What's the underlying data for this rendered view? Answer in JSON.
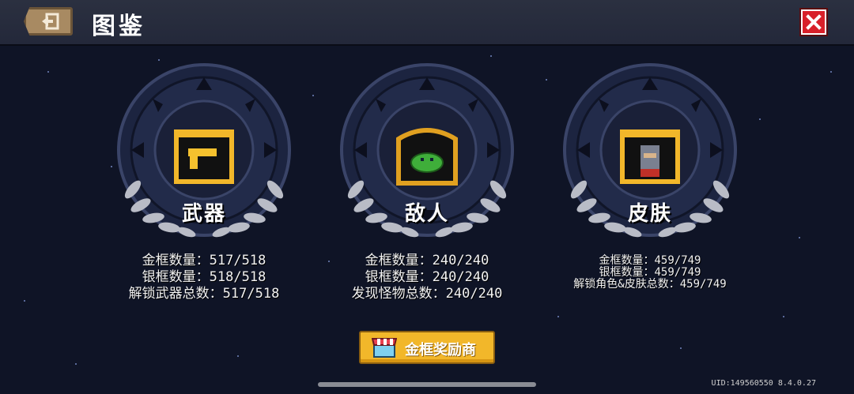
{
  "header": {
    "title": "图鉴",
    "back_icon": "exit-door-icon",
    "close_icon": "close-x-icon"
  },
  "colors": {
    "background": "#0f1426",
    "topbar": "#262b3c",
    "close": "#d8202a",
    "gold": "#f2b72a",
    "laurel": "#b9bcc6"
  },
  "cards": [
    {
      "label": "武器",
      "icon": "golden-gun-icon",
      "stats": [
        "金框数量：517/518",
        "银框数量：518/518",
        "解锁武器总数：517/518"
      ]
    },
    {
      "label": "敌人",
      "icon": "green-slime-icon",
      "stats": [
        "金框数量：240/240",
        "银框数量：240/240",
        "发现怪物总数：240/240"
      ]
    },
    {
      "label": "皮肤",
      "icon": "knight-portrait-icon",
      "stats": [
        "金框数量：459/749",
        "银框数量：459/749",
        "解锁角色&皮肤总数：459/749"
      ]
    }
  ],
  "reward_button": {
    "label": "金框奖励商",
    "icon": "shop-stall-icon"
  },
  "footer": {
    "uid": "UID:149560550 8.4.0.27"
  }
}
